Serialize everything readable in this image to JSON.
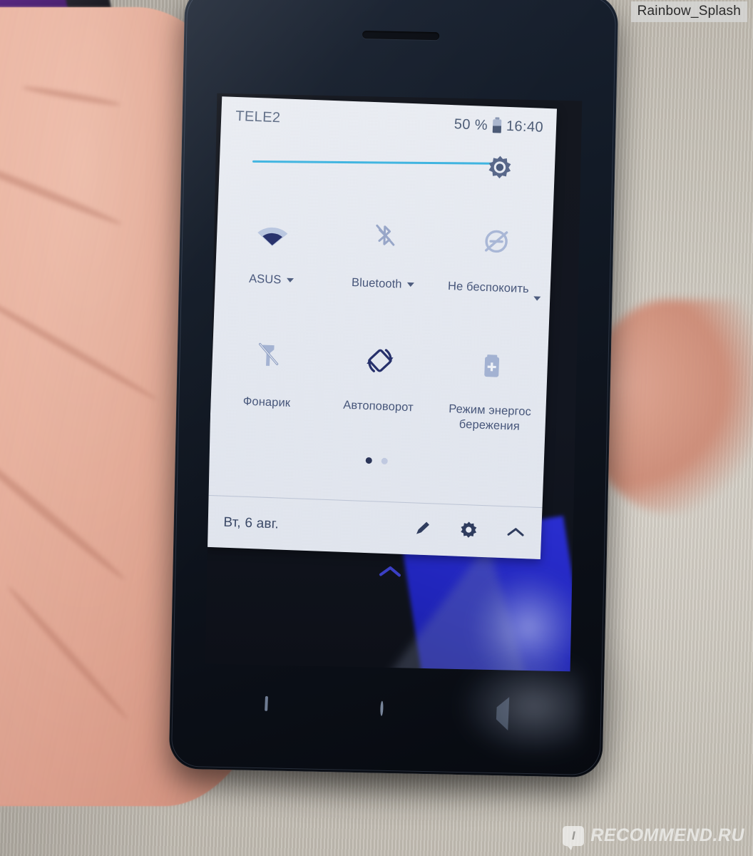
{
  "watermarks": {
    "top_right": "Rainbow_Splash",
    "bottom_right_mark": "I",
    "bottom_right_text": "RECOMMEND.RU"
  },
  "phone": {
    "status_bar": {
      "carrier": "TELE2",
      "battery_percent": "50 %",
      "battery_icon": "battery-half-icon",
      "clock": "16:40"
    },
    "brightness": {
      "name": "brightness-slider",
      "icon": "brightness-gear-icon",
      "value_percent": 92,
      "track_color": "#3fb4e0"
    },
    "quick_settings": {
      "tiles": [
        {
          "label": "ASUS",
          "icon": "wifi-icon",
          "state": "on",
          "has_caret": true,
          "caret_align": "inline"
        },
        {
          "label": "Bluetooth",
          "icon": "bluetooth-off-icon",
          "state": "off",
          "has_caret": true,
          "caret_align": "inline"
        },
        {
          "label": "Не беспокоить",
          "icon": "do-not-disturb-off-icon",
          "state": "off",
          "has_caret": true,
          "caret_align": "low"
        },
        {
          "label": "Фонарик",
          "icon": "flashlight-off-icon",
          "state": "off",
          "has_caret": false,
          "caret_align": "none"
        },
        {
          "label": "Автоповорот",
          "icon": "auto-rotate-icon",
          "state": "on",
          "has_caret": false,
          "caret_align": "none"
        },
        {
          "label": "Режим энергос бережения",
          "icon": "battery-saver-icon",
          "state": "off",
          "has_caret": false,
          "caret_align": "none"
        }
      ],
      "pages": {
        "count": 2,
        "active_index": 0
      },
      "footer": {
        "date": "Вт, 6 авг.",
        "actions": [
          {
            "name": "edit-tiles-button",
            "icon": "pencil-icon"
          },
          {
            "name": "settings-button",
            "icon": "gear-icon"
          },
          {
            "name": "collapse-panel-button",
            "icon": "chevron-up-icon"
          }
        ]
      }
    },
    "wallpaper": {
      "collapse_handle_icon": "chevron-up-icon",
      "accent_color": "#2a2ed0"
    },
    "nav_bar": {
      "buttons": [
        {
          "name": "recents-button",
          "icon": "square-icon"
        },
        {
          "name": "home-button",
          "icon": "circle-icon"
        },
        {
          "name": "back-button",
          "icon": "triangle-back-icon"
        }
      ]
    }
  }
}
